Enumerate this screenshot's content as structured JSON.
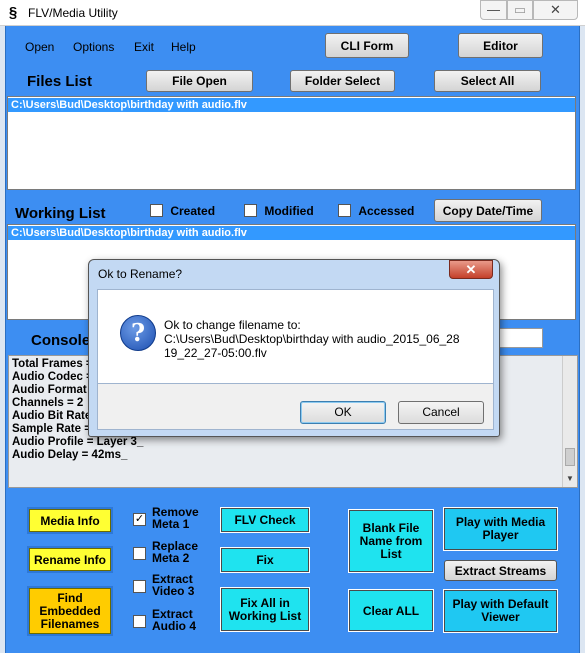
{
  "window": {
    "title": "FLV/Media Utility",
    "icon_glyph": "§",
    "controls": {
      "minimize": "—",
      "maximize": "▭",
      "close": "✕"
    }
  },
  "menu": [
    "Open",
    "Options",
    "Exit",
    "Help"
  ],
  "top_buttons": {
    "cli_form": "CLI Form",
    "editor": "Editor"
  },
  "files": {
    "heading": "Files List",
    "buttons": {
      "file_open": "File Open",
      "folder_select": "Folder Select",
      "select_all": "Select All"
    },
    "items": [
      "C:\\Users\\Bud\\Desktop\\birthday with audio.flv"
    ]
  },
  "working": {
    "heading": "Working List",
    "checkboxes": [
      {
        "label": "Created",
        "checked": false
      },
      {
        "label": "Modified",
        "checked": false
      },
      {
        "label": "Accessed",
        "checked": false
      }
    ],
    "copy_button": "Copy Date/Time",
    "items": [
      "C:\\Users\\Bud\\Desktop\\birthday with audio.flv"
    ]
  },
  "console": {
    "heading": "Console",
    "lines": [
      "Total Frames =",
      "Audio Codec =",
      "Audio Format =",
      "Channels = 2",
      "Audio Bit Rate",
      "Sample Rate =",
      "Audio Profile = Layer 3_",
      "Audio Delay = 42ms_"
    ]
  },
  "actions": {
    "media_info": "Media Info",
    "rename_info": "Rename Info",
    "find_embedded": "Find Embedded Filenames",
    "options": [
      {
        "label": "Remove Meta 1",
        "checked": true
      },
      {
        "label": "Replace Meta 2",
        "checked": false
      },
      {
        "label": "Extract Video 3",
        "checked": false
      },
      {
        "label": "Extract Audio 4",
        "checked": false
      }
    ],
    "flv_check": "FLV Check",
    "fix": "Fix",
    "fix_all": "Fix All in Working List",
    "blank_file_name": "Blank File Name from List",
    "clear_all": "Clear ALL",
    "play_media_player": "Play with Media Player",
    "extract_streams": "Extract Streams",
    "play_default_viewer": "Play with Default Viewer"
  },
  "dialog": {
    "title": "Ok to Rename?",
    "message_line1": "Ok to change filename to:",
    "message_line2": "C:\\Users\\Bud\\Desktop\\birthday with audio_2015_06_28",
    "message_line3": "19_22_27-05:00.flv",
    "ok": "OK",
    "cancel": "Cancel",
    "close": "✕",
    "icon": "?"
  },
  "colors": {
    "form_bg": "#3d8ef2",
    "selection": "#3399ff",
    "yellow_button": "#ffff33",
    "orange_button": "#ffcc00",
    "cyan_button": "#1fe3ef"
  }
}
